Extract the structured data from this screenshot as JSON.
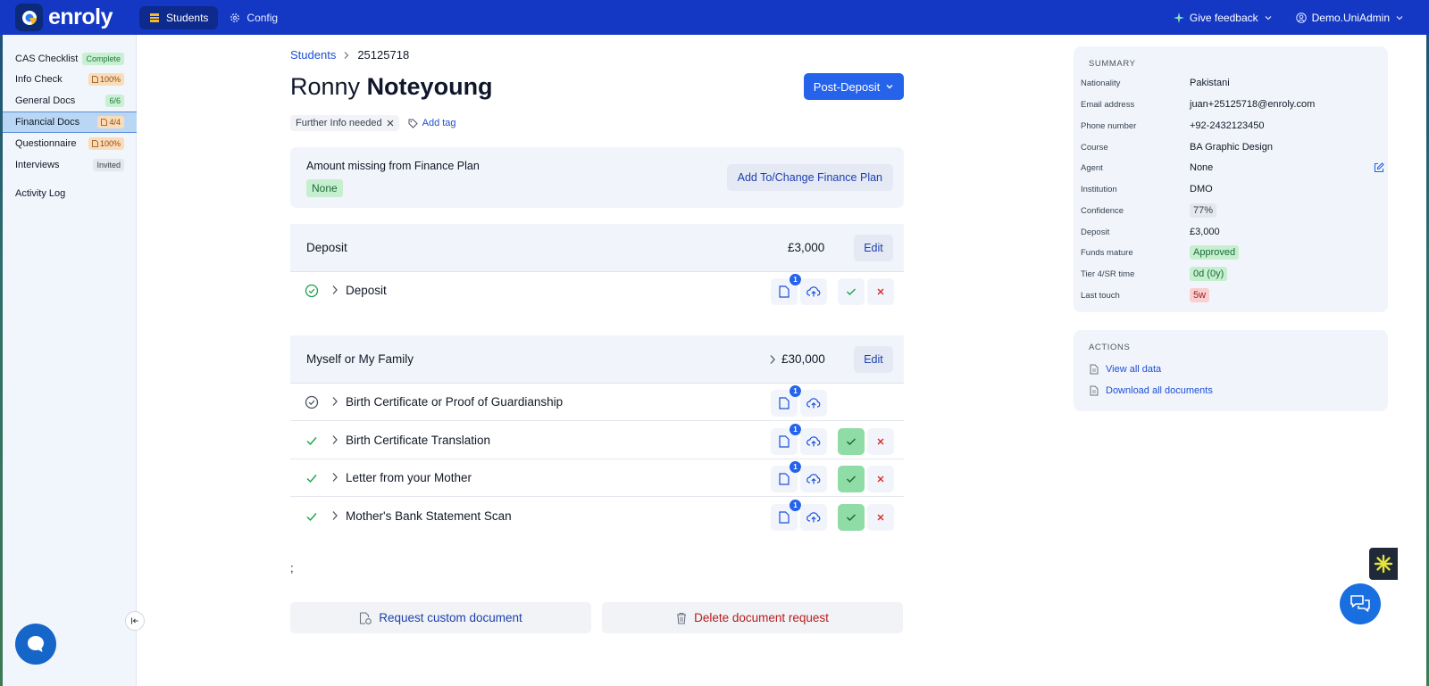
{
  "app": {
    "name": "enroly"
  },
  "nav": {
    "tabs": [
      {
        "label": "Students"
      },
      {
        "label": "Config"
      }
    ],
    "feedback": "Give feedback",
    "user": "Demo.UniAdmin"
  },
  "sidebar": {
    "items": [
      {
        "label": "CAS Checklist",
        "badge": "Complete"
      },
      {
        "label": "Info Check",
        "badge": "100%"
      },
      {
        "label": "General Docs",
        "badge": "6/6"
      },
      {
        "label": "Financial Docs",
        "badge": "4/4"
      },
      {
        "label": "Questionnaire",
        "badge": "100%"
      },
      {
        "label": "Interviews",
        "badge": "Invited"
      },
      {
        "label": "Activity Log",
        "badge": ""
      }
    ]
  },
  "breadcrumb": {
    "root": "Students",
    "current": "25125718"
  },
  "student": {
    "first_name": "Ronny",
    "last_name": "Noteyoung",
    "status": "Post-Deposit"
  },
  "tags": {
    "chip": "Further Info needed",
    "add": "Add tag"
  },
  "finance": {
    "label": "Amount missing from Finance Plan",
    "value": "None",
    "button": "Add To/Change Finance Plan"
  },
  "sections": [
    {
      "title": "Deposit",
      "amount": "£3,000",
      "edit": "Edit",
      "docs": [
        {
          "name": "Deposit",
          "count": "1"
        }
      ]
    },
    {
      "title": "Myself or My Family",
      "amount": "£30,000",
      "edit": "Edit",
      "docs": [
        {
          "name": "Birth Certificate or Proof of Guardianship",
          "count": "1"
        },
        {
          "name": "Birth Certificate Translation",
          "count": "1"
        },
        {
          "name": "Letter from your Mother",
          "count": "1"
        },
        {
          "name": "Mother's Bank Statement Scan",
          "count": "1"
        }
      ]
    }
  ],
  "stray_text": ";",
  "bottom": {
    "request": "Request custom document",
    "delete": "Delete document request"
  },
  "summary": {
    "heading": "SUMMARY",
    "rows": [
      {
        "key": "Nationality",
        "value": "Pakistani"
      },
      {
        "key": "Email address",
        "value": "juan+25125718@enroly.com"
      },
      {
        "key": "Phone number",
        "value": "+92-2432123450"
      },
      {
        "key": "Course",
        "value": "BA Graphic Design"
      },
      {
        "key": "Agent",
        "value": "None"
      },
      {
        "key": "Institution",
        "value": "DMO"
      },
      {
        "key": "Confidence",
        "value": "77%"
      },
      {
        "key": "Deposit",
        "value": "£3,000"
      },
      {
        "key": "Funds mature",
        "value": "Approved"
      },
      {
        "key": "Tier 4/SR time",
        "value": "0d (0y)"
      },
      {
        "key": "Last touch",
        "value": "5w"
      }
    ]
  },
  "actions": {
    "heading": "ACTIONS",
    "view": "View all data",
    "download": "Download all documents"
  },
  "colors": {
    "brand": "#1438c4",
    "accent": "#2563eb",
    "approve": "#8fdca6",
    "reject": "#dc2626"
  }
}
